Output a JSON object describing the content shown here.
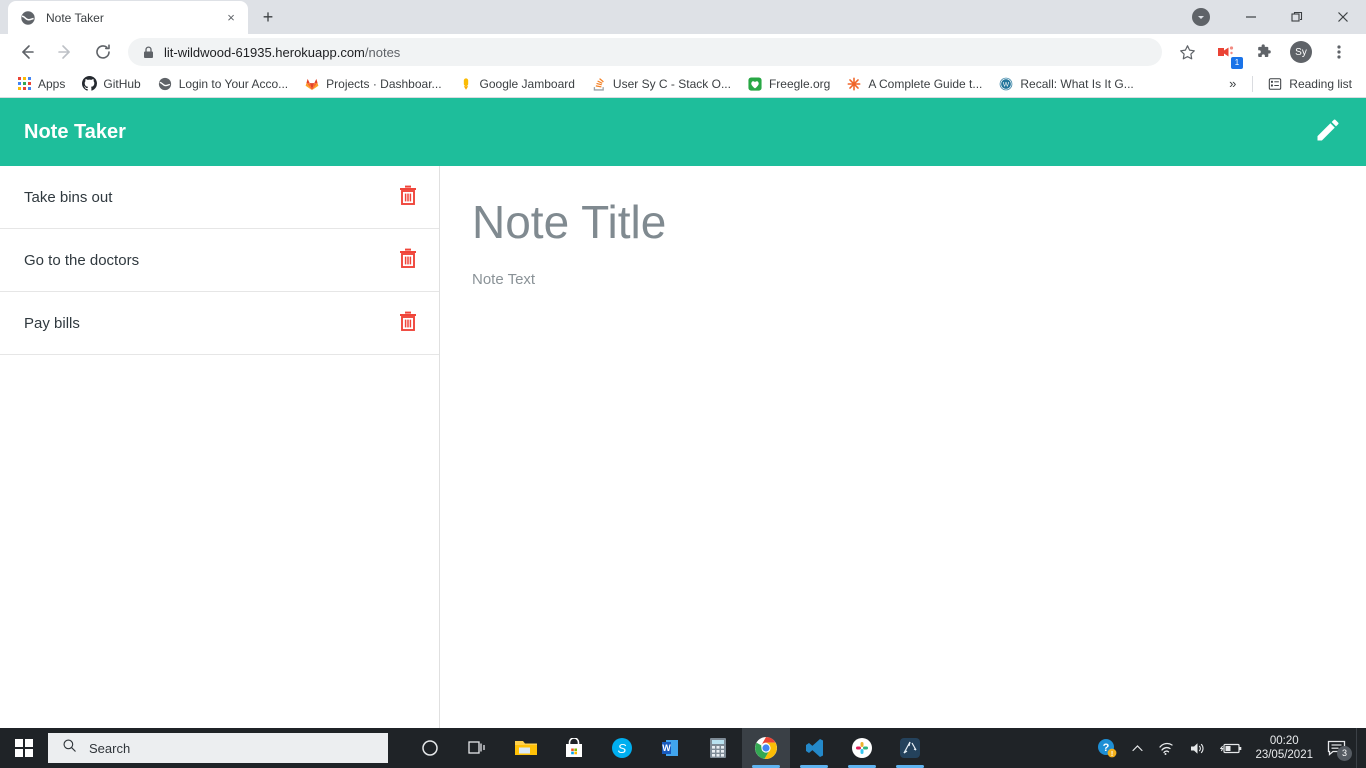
{
  "browser": {
    "tab": {
      "title": "Note Taker",
      "favicon": "globe-icon",
      "close": "×"
    },
    "new_tab_label": "+",
    "window_controls": {
      "download_indicator": "download-chevron-icon",
      "minimize": "—",
      "restore": "restore-icon",
      "close": "✕"
    },
    "nav": {
      "back": "back-arrow-icon",
      "forward": "forward-arrow-icon",
      "reload": "reload-icon"
    },
    "omnibox": {
      "lock": "lock-icon",
      "host": "lit-wildwood-61935.herokuapp.com",
      "path": "/notes"
    },
    "actions": {
      "bookmark_star": "star-icon",
      "media_extension_badge": "1",
      "extensions": "puzzle-icon",
      "profile_initials": "Sy",
      "menu": "kebab-menu-icon"
    },
    "bookmarks": [
      {
        "label": "Apps",
        "icon": "apps-grid-icon"
      },
      {
        "label": "GitHub",
        "icon": "github-icon"
      },
      {
        "label": "Login to Your Acco...",
        "icon": "globe-icon"
      },
      {
        "label": "Projects · Dashboar...",
        "icon": "gitlab-icon"
      },
      {
        "label": "Google Jamboard",
        "icon": "jamboard-icon"
      },
      {
        "label": "User Sy C - Stack O...",
        "icon": "stackoverflow-icon"
      },
      {
        "label": "Freegle.org",
        "icon": "freegle-icon"
      },
      {
        "label": "A Complete Guide t...",
        "icon": "css-tricks-icon"
      },
      {
        "label": "Recall: What Is It G...",
        "icon": "wordpress-icon"
      }
    ],
    "bookmarks_overflow": "»",
    "reading_list": {
      "label": "Reading list",
      "icon": "reading-list-icon"
    }
  },
  "app": {
    "title": "Note Taker",
    "new_note_icon": "pencil-icon",
    "notes": [
      {
        "title": "Take bins out",
        "delete_icon": "trash-icon"
      },
      {
        "title": "Go to the doctors",
        "delete_icon": "trash-icon"
      },
      {
        "title": "Pay bills",
        "delete_icon": "trash-icon"
      }
    ],
    "editor": {
      "title_placeholder": "Note Title",
      "title_value": "Note Title",
      "text_placeholder": "Note Text",
      "text_value": "Note Text"
    },
    "colors": {
      "header": "#1EBE9B",
      "delete": "#F0453A"
    }
  },
  "taskbar": {
    "start": "windows-start-icon",
    "search_placeholder": "Search",
    "search_icon": "search-icon",
    "apps": [
      {
        "name": "cortana-icon"
      },
      {
        "name": "task-view-icon"
      },
      {
        "name": "file-explorer-icon"
      },
      {
        "name": "microsoft-store-icon"
      },
      {
        "name": "skype-icon"
      },
      {
        "name": "word-icon"
      },
      {
        "name": "calculator-icon"
      },
      {
        "name": "chrome-icon"
      },
      {
        "name": "vscode-icon"
      },
      {
        "name": "slack-icon"
      },
      {
        "name": "design-app-icon"
      }
    ],
    "tray": {
      "help_icon": "help-question-icon",
      "chevron_up": "show-hidden-icons-icon",
      "network_icon": "wifi-icon",
      "volume_icon": "speaker-icon",
      "battery_icon": "battery-charging-icon",
      "time": "00:20",
      "date": "23/05/2021",
      "notifications_icon": "action-center-icon",
      "notifications_count": "3"
    }
  }
}
